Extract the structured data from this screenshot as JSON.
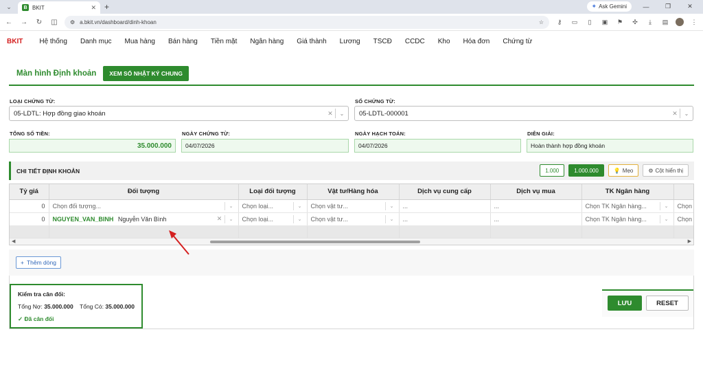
{
  "browser": {
    "tab_title": "BKIT",
    "favicon_letter": "B",
    "url": "a.bkit.vn/dashboard/dinh-khoan",
    "ask_gemini": "Ask Gemini"
  },
  "nav": {
    "brand": "BKIT",
    "items": [
      "Hệ thống",
      "Danh mục",
      "Mua hàng",
      "Bán hàng",
      "Tiền mặt",
      "Ngân hàng",
      "Giá thành",
      "Lương",
      "TSCĐ",
      "CCDC",
      "Kho",
      "Hóa đơn",
      "Chứng từ"
    ]
  },
  "page": {
    "title": "Màn hình Định khoản",
    "journal_button": "XEM SỔ NHẬT KÝ CHUNG"
  },
  "form": {
    "voucher_type_label": "LOẠI CHỨNG TỪ:",
    "voucher_type_value": "05-LDTL: Hợp đồng giao khoán",
    "voucher_no_label": "SỐ CHỨNG TỪ:",
    "voucher_no_value": "05-LDTL-000001",
    "total_label": "TỔNG SỐ TIỀN:",
    "total_value": "35.000.000",
    "voucher_date_label": "NGÀY CHỨNG TỪ:",
    "voucher_date_value": "04/07/2026",
    "posting_date_label": "NGÀY HẠCH TOÁN:",
    "posting_date_value": "04/07/2026",
    "description_label": "DIỄN GIẢI:",
    "description_value": "Hoàn thành hợp đồng khoán"
  },
  "detail": {
    "title": "CHI TIẾT ĐỊNH KHOẢN",
    "btn_1000": "1.000",
    "btn_1000000": "1.000.000",
    "btn_tips": "Mẹo",
    "btn_columns": "Cột hiển thị",
    "columns": [
      "Tỷ giá",
      "Đối tượng",
      "Loại đối tượng",
      "Vật tư/Hàng hóa",
      "Dịch vụ cung cấp",
      "Dịch vụ mua",
      "TK Ngân hàng",
      ""
    ],
    "rows": [
      {
        "rate": "0",
        "object_placeholder": "Chọn đối tượng...",
        "object_type": "Chọn loại...",
        "material": "Chọn vật tư...",
        "service_provided": "...",
        "service_bought": "...",
        "bank_account": "Chọn TK Ngân hàng...",
        "extra": "Chọn"
      },
      {
        "rate": "0",
        "object_code": "NGUYEN_VAN_BINH",
        "object_name": "Nguyễn Văn Bình",
        "object_type": "Chọn loại...",
        "material": "Chọn vật tư...",
        "service_provided": "...",
        "service_bought": "...",
        "bank_account": "Chọn TK Ngân hàng...",
        "extra": "Chọn"
      }
    ],
    "add_row": "Thêm dòng"
  },
  "balance": {
    "title": "Kiểm tra cân đối:",
    "debit_label": "Tổng Nợ:",
    "debit_value": "35.000.000",
    "credit_label": "Tổng Có:",
    "credit_value": "35.000.000",
    "status": "✓ Đã cân đối"
  },
  "actions": {
    "save": "LƯU",
    "reset": "RESET"
  },
  "colors": {
    "accent": "#2e8b2e",
    "brand": "#d42020",
    "annotation_arrow": "#d42020"
  }
}
